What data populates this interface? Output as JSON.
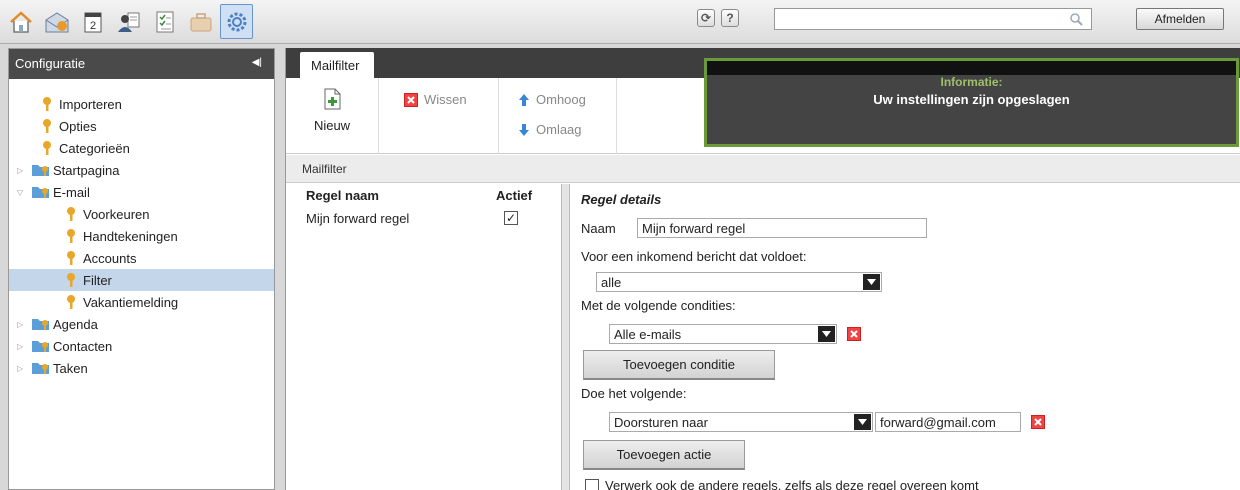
{
  "topbar": {
    "apps": [
      "home-icon",
      "mail-icon",
      "calendar-icon",
      "contacts-icon",
      "tasks-icon",
      "briefcase-icon",
      "settings-icon"
    ],
    "refresh_icon": "refresh-icon",
    "help_label": "?",
    "search_placeholder": "",
    "logout_label": "Afmelden"
  },
  "sidebar": {
    "title": "Configuratie",
    "items": [
      {
        "label": "Importeren"
      },
      {
        "label": "Opties"
      },
      {
        "label": "Categorieën"
      },
      {
        "label": "Startpagina"
      },
      {
        "label": "E-mail"
      },
      {
        "label": "Voorkeuren"
      },
      {
        "label": "Handtekeningen"
      },
      {
        "label": "Accounts"
      },
      {
        "label": "Filter"
      },
      {
        "label": "Vakantiemelding"
      },
      {
        "label": "Agenda"
      },
      {
        "label": "Contacten"
      },
      {
        "label": "Taken"
      }
    ]
  },
  "main": {
    "tab": "Mailfilter",
    "actions": {
      "new": "Nieuw",
      "delete": "Wissen",
      "up": "Omhoog",
      "down": "Omlaag"
    },
    "info": {
      "title": "Informatie:",
      "message": "Uw instellingen zijn opgeslagen"
    },
    "breadcrumb": "Mailfilter",
    "list": {
      "col_name": "Regel naam",
      "col_active": "Actief",
      "rows": [
        {
          "name": "Mijn forward regel",
          "active": "✓"
        }
      ]
    },
    "detail": {
      "heading": "Regel details",
      "name_label": "Naam",
      "name_value": "Mijn forward regel",
      "match_label": "Voor een inkomend bericht dat voldoet:",
      "match_value": "alle",
      "conditions_label": "Met de volgende condities:",
      "condition_value": "Alle e-mails",
      "add_condition": "Toevoegen conditie",
      "do_label": "Doe het volgende:",
      "action_value": "Doorsturen naar",
      "action_target": "forward@gmail.com",
      "add_action": "Toevoegen actie",
      "continue_label": "Verwerk ook de andere regels, zelfs als deze regel overeen komt"
    }
  },
  "colors": {
    "accent_green": "#6b9a3a",
    "selection": "#c4d6ea",
    "header_dark": "#3e3e3e"
  }
}
